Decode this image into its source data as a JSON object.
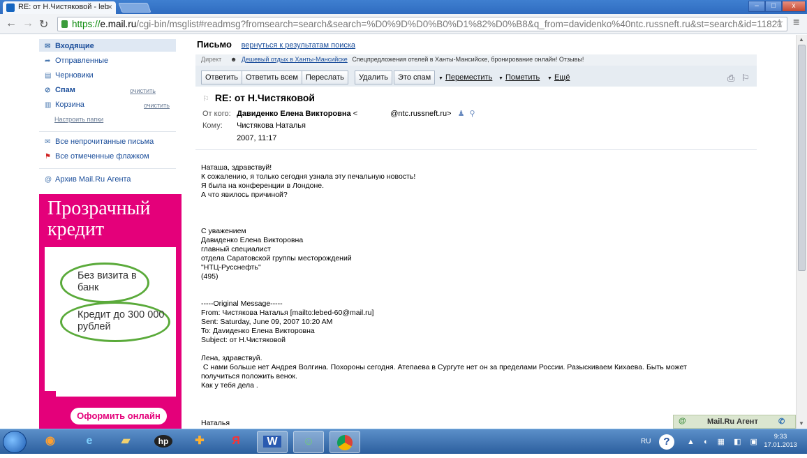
{
  "browser": {
    "tab_title": "RE: от Н.Чистяковой - leb",
    "tab_close": "×",
    "url_scheme": "https://",
    "url_host": "e.mail.ru",
    "url_path": "/cgi-bin/msglist#readmsg?fromsearch=search&search=%D0%9D%D0%B0%D1%82%D0%B8&q_from=davidenko%40ntc.russneft.ru&st=search&id=11821"
  },
  "sidebar": {
    "folders": [
      {
        "label": "Входящие",
        "icon": "envelope-icon"
      },
      {
        "label": "Отправленные",
        "icon": "sent-arrow-icon"
      },
      {
        "label": "Черновики",
        "icon": "drafts-icon"
      },
      {
        "label": "Спам",
        "icon": "spam-icon",
        "clean": "очистить"
      },
      {
        "label": "Корзина",
        "icon": "trash-icon",
        "clean": "очистить"
      }
    ],
    "setup_folders": "Настроить папки",
    "unread_link": "Все непрочитанные письма",
    "flagged_link": "Все отмеченные флажком",
    "archive_link": "Архив Mail.Ru Агента",
    "ad": {
      "title": "Прозрачный кредит",
      "pill1": "Без визита в банк",
      "pill2": "Кредит до 300 000 рублей",
      "button": "Оформить онлайн",
      "brand_color": "#e4007a",
      "pill_color": "#5aaa3a"
    }
  },
  "main": {
    "page_title": "Письмо",
    "back_link": "вернуться к результатам поиска",
    "direct": {
      "label": "Директ",
      "link": "Дешевый отдых в Ханты-Мансийске",
      "text": "Спецпредложения отелей в Ханты-Мансийске, бронирование онлайн! Отзывы!"
    },
    "actions": {
      "reply": "Ответить",
      "reply_all": "Ответить всем",
      "forward": "Переслать",
      "delete": "Удалить",
      "spam": "Это спам",
      "move": "Переместить",
      "mark": "Пометить",
      "more": "Ещё"
    },
    "message": {
      "subject": "RE: от Н.Чистяковой",
      "from_label": "От кого:",
      "from_name": "Давиденко Елена Викторовна",
      "from_bracket_open": "<",
      "from_email_tail": "@ntc.russneft.ru>",
      "to_label": "Кому:",
      "to_name": "Чистякова Наталья",
      "date": "2007, 11:17",
      "body": "Наташа, здравствуй!\nК сожалению, я только сегодня узнала эту печальную новость!\nЯ была на конференции в Лондоне.\nА что явилось причиной?\n\n\n\nС уважением\nДавиденко Елена Викторовна\nглавный специалист\nотдела Саратовской группы месторождений\n\"НТЦ-Русснефть\"\n(495)\n\n\n-----Original Message-----\nFrom: Чистякова Наталья [mailto:lebed-60@mail.ru]\nSent: Saturday, June 09, 2007 10:20 AM\nTo: Даvиденко Елена Викторовна\nSubject: от Н.Чистяковой\n\nЛена, здравствуй.\n С нами больше нет Андрея Волгина. Похороны сегодня. Атепаева в Сургуте нет он за пределами России. Разыскиваем Кихаева. Быть может\nполучиться положить венок.\nКак у тебя дела .",
      "signature": "Наталья"
    }
  },
  "agent": {
    "title": "Mail.Ru Агент",
    "at_symbol": "@",
    "phone_icon": "phone-icon"
  },
  "taskbar": {
    "language": "RU",
    "help": "?",
    "time": "9:33",
    "date": "17.01.2013",
    "yandex_letter": "Я",
    "word_letter": "W"
  }
}
